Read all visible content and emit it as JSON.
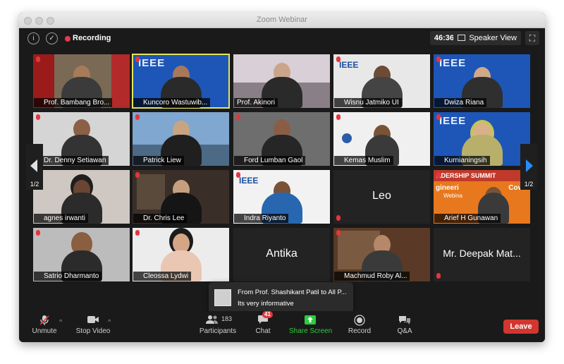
{
  "window": {
    "title": "Zoom Webinar"
  },
  "topbar": {
    "recording_label": "Recording",
    "timer": "46:36",
    "view_label": "Speaker View"
  },
  "participants": [
    "Prof. Bambang Bro...",
    "Kuncoro Wastuwib...",
    "Prof. Akinori",
    "Wisnu Jatmiko UI",
    "Dwiza Riana",
    "Dr. Denny Setiawan",
    "Patrick Liew",
    "Ford Lumban Gaol",
    "Kemas Muslim",
    "Kurnianingsih",
    "agnes irwanti",
    "Dr. Chris Lee",
    "Indra Riyanto",
    "Leo",
    "Arief H Gunawan",
    "Satrio Dharmanto",
    "Cleossa Lydwi",
    "Antika",
    "Machmud Roby Al...",
    "Mr. Deepak Mat..."
  ],
  "tile_text": {
    "ieee": "IEEE",
    "ieee_section": "IEEE",
    "banner": "ADERSHIP SUMMIT",
    "banner_sub": "gineeri",
    "banner_sub2": "Covid",
    "banner_sub3": "Webina"
  },
  "pagination": {
    "left": "1/2",
    "right": "1/2"
  },
  "chat_notice": {
    "from": "From Prof. Shashikant Patil to All P...",
    "message": "Its very informative"
  },
  "toolbar": {
    "unmute": "Unmute",
    "stop_video": "Stop Video",
    "participants": "Participants",
    "participants_count": "183",
    "chat": "Chat",
    "chat_badge": "41",
    "share_screen": "Share Screen",
    "record": "Record",
    "qa": "Q&A",
    "leave": "Leave"
  },
  "colors": {
    "accent_green": "#2ecc40",
    "leave_red": "#d2372f",
    "active_border": "#e6e45c",
    "arrow_blue": "#2a8cff"
  }
}
